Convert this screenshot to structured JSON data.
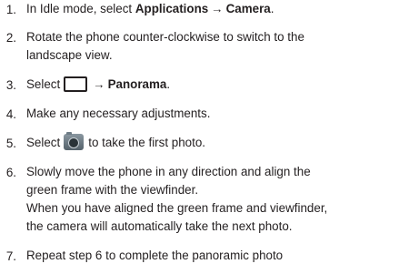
{
  "steps": [
    {
      "num": "1.",
      "pre": "In Idle mode, select ",
      "b1": "Applications",
      "arrow": "→",
      "b2": "Camera",
      "post": "."
    },
    {
      "num": "2.",
      "line1": "Rotate the phone counter-clockwise to switch to the",
      "line2": "landscape view."
    },
    {
      "num": "3.",
      "pre": "Select",
      "arrow": "→",
      "b1": "Panorama",
      "post": ".",
      "icon": "mode-button-icon"
    },
    {
      "num": "4.",
      "line1": "Make any necessary adjustments."
    },
    {
      "num": "5.",
      "pre": "Select",
      "post": "to take the first photo.",
      "icon": "camera-icon"
    },
    {
      "num": "6.",
      "line1": "Slowly move the phone in any direction and align the",
      "line2": "green frame with the viewfinder.",
      "line3": "When you have aligned the green frame and viewfinder,",
      "line4": "the camera will automatically take the next photo."
    },
    {
      "num": "7.",
      "line1": "Repeat step 6 to complete the panoramic photo"
    }
  ]
}
